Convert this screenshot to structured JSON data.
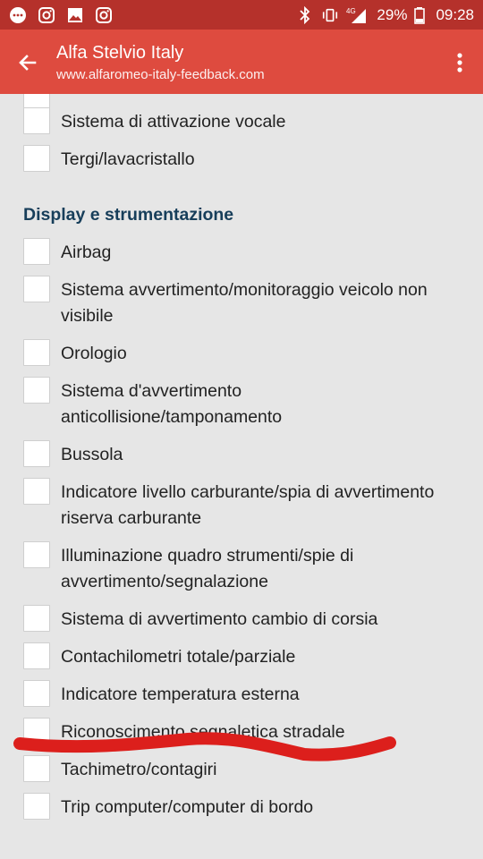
{
  "status_bar": {
    "battery": "29%",
    "time": "09:28",
    "network": "4G",
    "icons": [
      "messenger-icon",
      "instagram-icon",
      "image-icon",
      "instagram-icon",
      "bluetooth-icon",
      "vibrate-icon",
      "signal-icon",
      "battery-icon"
    ]
  },
  "toolbar": {
    "title": "Alfa Stelvio Italy",
    "url": "www.alfaromeo-italy-feedback.com"
  },
  "list_top": [
    "Sistema di attivazione vocale",
    "Tergi/lavacristallo"
  ],
  "section": {
    "title": "Display e strumentazione",
    "items": [
      "Airbag",
      "Sistema avvertimento/monitoraggio veicolo non visibile",
      "Orologio",
      "Sistema d'avvertimento anticollisione/tamponamento",
      "Bussola",
      "Indicatore livello carburante/spia di avvertimento riserva carburante",
      "Illuminazione quadro strumenti/spie di avvertimento/segnalazione",
      "Sistema di avvertimento cambio di corsia",
      "Contachilometri totale/parziale",
      "Indicatore temperatura esterna",
      "Riconoscimento segnaletica stradale",
      "Tachimetro/contagiri",
      "Trip computer/computer di bordo"
    ]
  },
  "colors": {
    "status_bar": "#b5312b",
    "toolbar": "#de4b3f",
    "section_title": "#173e5a",
    "annotation_stroke": "#dc1f1c"
  }
}
